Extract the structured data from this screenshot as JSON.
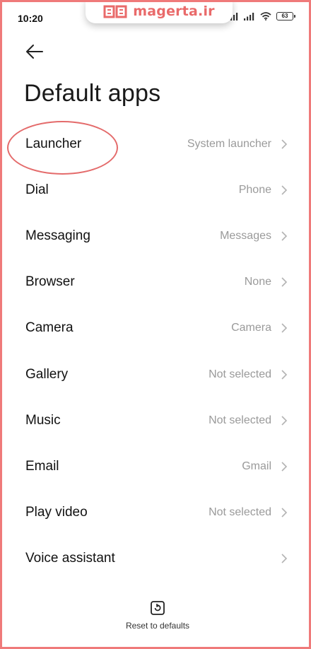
{
  "status_bar": {
    "time": "10:20",
    "battery": "63",
    "icons": [
      "signal-icon",
      "signal-icon",
      "wifi-icon",
      "battery-icon"
    ]
  },
  "watermark": {
    "text": "magerta.ir",
    "icon": "book-logo-icon",
    "color": "#e96a6a"
  },
  "header": {
    "back_icon": "back-arrow-icon",
    "title": "Default apps"
  },
  "items": [
    {
      "label": "Launcher",
      "value": "System launcher"
    },
    {
      "label": "Dial",
      "value": "Phone"
    },
    {
      "label": "Messaging",
      "value": "Messages"
    },
    {
      "label": "Browser",
      "value": "None"
    },
    {
      "label": "Camera",
      "value": "Camera"
    },
    {
      "label": "Gallery",
      "value": "Not selected"
    },
    {
      "label": "Music",
      "value": "Not selected"
    },
    {
      "label": "Email",
      "value": "Gmail"
    },
    {
      "label": "Play video",
      "value": "Not selected"
    },
    {
      "label": "Voice assistant",
      "value": ""
    }
  ],
  "footer": {
    "reset_label": "Reset to defaults",
    "reset_icon": "reset-icon"
  },
  "colors": {
    "border": "#ef7a7a",
    "highlight": "#e46b6b",
    "secondary_text": "#9a9a9a"
  }
}
